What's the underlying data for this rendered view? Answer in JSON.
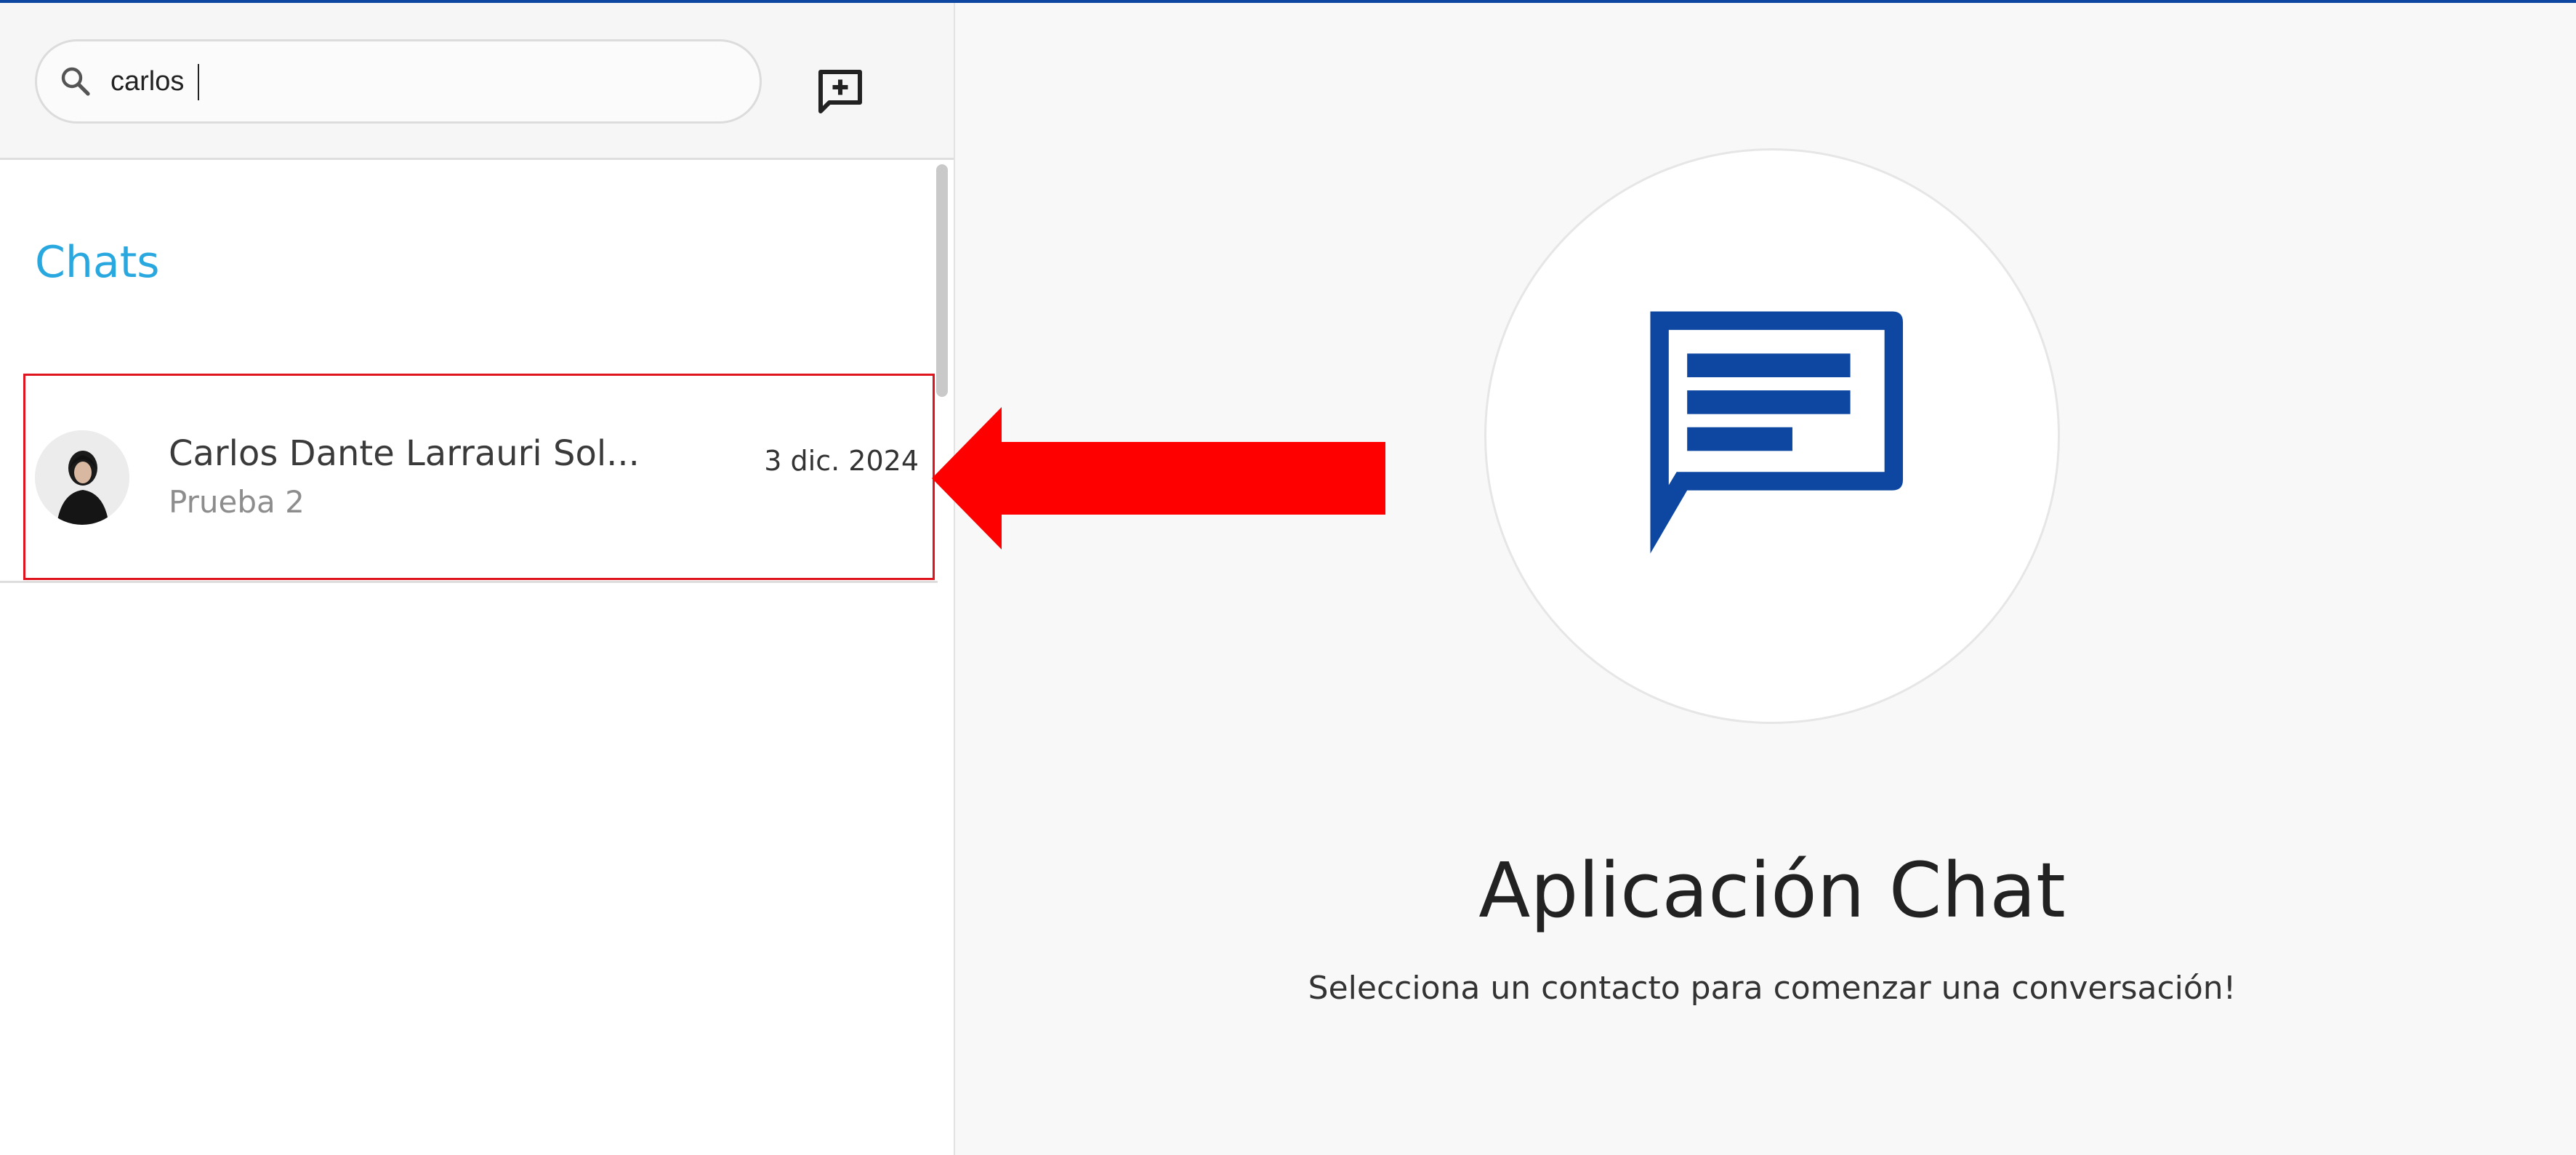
{
  "colors": {
    "accent": "#29a8e0",
    "brand": "#0d47a1",
    "annotation": "#e0141e"
  },
  "search": {
    "value": "carlos",
    "icon": "search-icon"
  },
  "sidebar": {
    "new_chat_icon": "add-chat-icon",
    "section_title": "Chats",
    "chats": [
      {
        "name": "Carlos Dante Larrauri Sol...",
        "preview": "Prueba 2",
        "date": "3 dic. 2024"
      }
    ]
  },
  "main": {
    "icon": "chat-bubble-icon",
    "title": "Aplicación Chat",
    "subtitle": "Selecciona un contacto para comenzar una conversación!"
  }
}
